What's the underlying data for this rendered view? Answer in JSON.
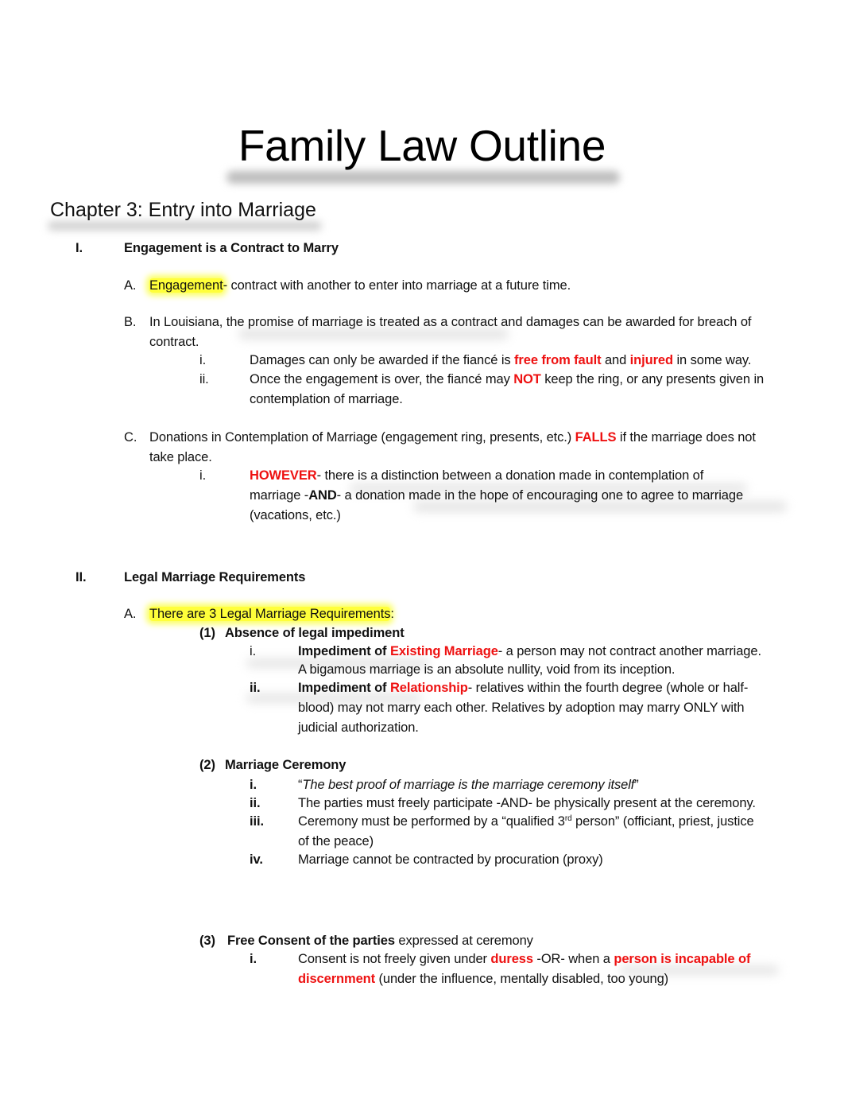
{
  "document": {
    "title": "Family Law Outline",
    "chapter": "Chapter 3: Entry into Marriage"
  },
  "section_1": {
    "numeral": "I.",
    "heading": "Engagement is a Contract to Marry",
    "A": {
      "label": "A.",
      "term": "Engagement",
      "text": "- contract with another to enter into marriage at a future time."
    },
    "B": {
      "label": "B.",
      "line1": "In Louisiana, the promise of marriage is treated as a contract and damages can be awarded for breach of",
      "line2": "contract.",
      "i": {
        "label": "i.",
        "pre": "Damages can only be awarded if the fiancé is ",
        "red1": "free from fault",
        "mid": " and ",
        "red2": "injured",
        "post": " in some way."
      },
      "ii": {
        "label": "ii.",
        "pre": "Once the engagement is over, the fiancé may ",
        "red": "NOT",
        "post": " keep the ring, or any presents given in",
        "line2": "contemplation of marriage."
      }
    },
    "C": {
      "label": "C.",
      "pre": "Donations in Contemplation of Marriage (engagement ring, presents, etc.) ",
      "red": "FALLS",
      "post": " if the marriage does not",
      "line2": "take place.",
      "i": {
        "label": "i.",
        "red": "HOWEVER",
        "post": "- there is a distinction between a donation made in contemplation of",
        "line2_pre": "marriage -",
        "line2_bold": "AND",
        "line2_post": "- a donation made in the hope of encouraging one to agree to marriage",
        "line3": "(vacations, etc.)"
      }
    }
  },
  "section_2": {
    "numeral": "II.",
    "heading": "Legal Marriage Requirements",
    "A": {
      "label": "A.",
      "text": "There are 3 Legal Marriage Requirements",
      "colon": ":"
    },
    "req1": {
      "label": "(1)",
      "title": "Absence of legal impediment",
      "i": {
        "label": "i.",
        "bold": "Impediment of ",
        "red": "Existing Marriage",
        "post": "- a person may not contract another marriage.",
        "line2": "A bigamous marriage is an absolute nullity, void from its inception."
      },
      "ii": {
        "label": "ii.",
        "bold": "Impediment of ",
        "red": "Relationship",
        "post": "- relatives within the fourth degree (whole or half-",
        "line2": "blood) may not marry each other. Relatives by adoption may marry ONLY with",
        "line3": "judicial authorization."
      }
    },
    "req2": {
      "label": "(2)",
      "title": "Marriage Ceremony",
      "i": {
        "label": "i.",
        "open_quote": "“",
        "italic": "The best proof of marriage is the marriage ceremony itself",
        "close_quote": "”"
      },
      "ii": {
        "label": "ii.",
        "text": "The parties must freely participate -AND- be physically present at the ceremony."
      },
      "iii": {
        "label": "iii.",
        "pre": "Ceremony must be performed by a “qualified 3",
        "sup": "rd",
        "post": " person” (officiant, priest, justice",
        "line2": "of the peace)"
      },
      "iv": {
        "label": "iv.",
        "text": "Marriage cannot be contracted by procuration (proxy)"
      }
    },
    "req3": {
      "label": "(3)",
      "title": "Free Consent of the parties",
      "title_post": " expressed at ceremony",
      "i": {
        "label": "i.",
        "pre": "Consent is not freely given under ",
        "red1": "duress",
        "mid": " -OR- when a ",
        "red2": "person is incapable of",
        "line2_red": "discernment",
        "line2_post": " (under the influence, mentally disabled, too young)"
      }
    }
  },
  "colors": {
    "emphasis_red": "#ee1111",
    "highlight_yellow": "#ffff3a"
  }
}
